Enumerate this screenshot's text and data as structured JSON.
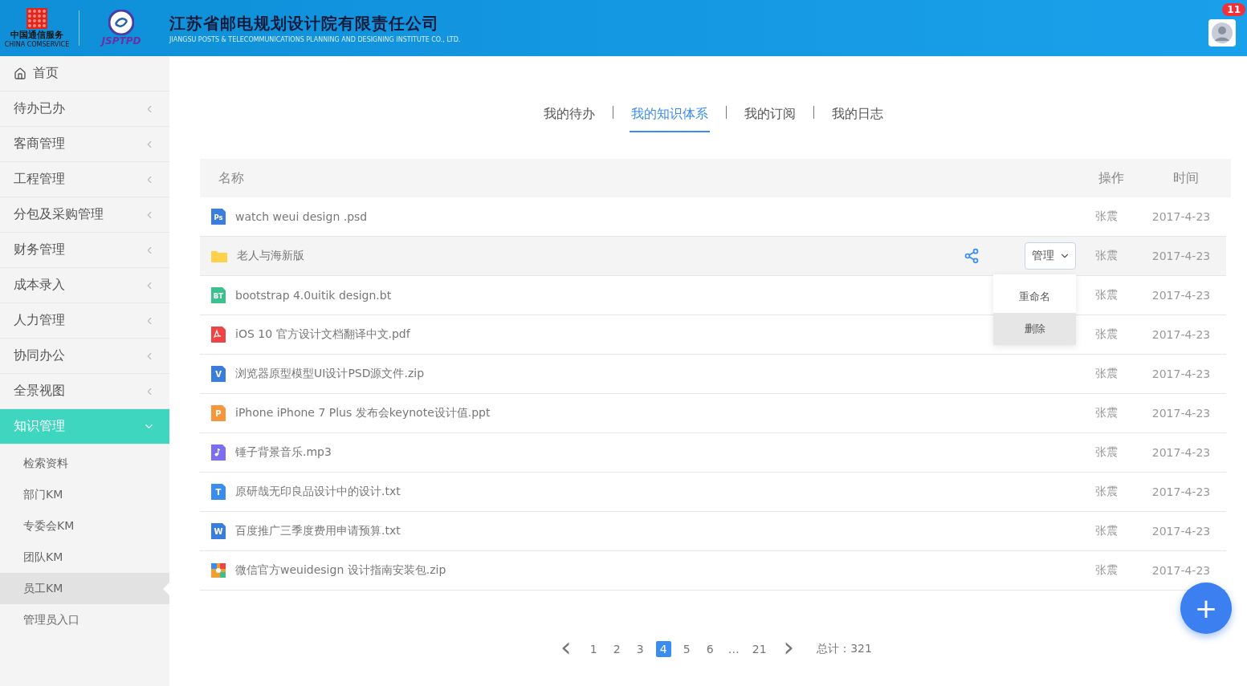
{
  "header": {
    "company": "江苏省邮电规划设计院有限责任公司",
    "company_en": "JIANGSU POSTS & TELECOMMUNICATIONS PLANNING AND DESIGNING INSTITUTE CO., LTD.",
    "logo_cn": "中国通信服务",
    "logo_en": "CHINA COMSERVICE",
    "logo2": "JSPTPD",
    "notifications": "11"
  },
  "sidebar": {
    "items": [
      {
        "label": "首页",
        "kind": "home",
        "selected": false
      },
      {
        "label": "待办已办",
        "kind": "group",
        "expanded": false,
        "selected": false
      },
      {
        "label": "客商管理",
        "kind": "group",
        "expanded": false,
        "selected": false
      },
      {
        "label": "工程管理",
        "kind": "group",
        "expanded": false,
        "selected": false
      },
      {
        "label": "分包及采购管理",
        "kind": "group",
        "expanded": false,
        "selected": false
      },
      {
        "label": "财务管理",
        "kind": "group",
        "expanded": false,
        "selected": false
      },
      {
        "label": "成本录入",
        "kind": "group",
        "expanded": false,
        "selected": false
      },
      {
        "label": "人力管理",
        "kind": "group",
        "expanded": false,
        "selected": false
      },
      {
        "label": "协同办公",
        "kind": "group",
        "expanded": false,
        "selected": false
      },
      {
        "label": "全景视图",
        "kind": "group",
        "expanded": false,
        "selected": false
      },
      {
        "label": "知识管理",
        "kind": "group",
        "expanded": true,
        "selected": true,
        "children": [
          {
            "label": "检索资料",
            "selected": false
          },
          {
            "label": "部门KM",
            "selected": false
          },
          {
            "label": "专委会KM",
            "selected": false
          },
          {
            "label": "团队KM",
            "selected": false
          },
          {
            "label": "员工KM",
            "selected": true
          },
          {
            "label": "管理员入口",
            "selected": false
          }
        ]
      }
    ]
  },
  "tabs": [
    {
      "label": "我的待办",
      "selected": false
    },
    {
      "label": "我的知识体系",
      "selected": true
    },
    {
      "label": "我的订阅",
      "selected": false
    },
    {
      "label": "我的日志",
      "selected": false
    }
  ],
  "table": {
    "columns": [
      "名称",
      "操作",
      "时间"
    ],
    "rows": [
      {
        "icon": {
          "kind": "doc",
          "badge": "Ps",
          "color": "#3b7ddd"
        },
        "name": "watch weui design .psd",
        "author": "张震",
        "date": "2017-4-23",
        "selected": false
      },
      {
        "icon": {
          "kind": "folder",
          "color": "#ffd04a"
        },
        "name": "老人与海新版",
        "author": "张震",
        "date": "2017-4-23",
        "selected": true,
        "manage": "管理",
        "menu": [
          {
            "label": "重命名",
            "selected": false
          },
          {
            "label": "删除",
            "selected": true
          }
        ]
      },
      {
        "icon": {
          "kind": "doc",
          "badge": "BT",
          "color": "#3cc08f"
        },
        "name": "bootstrap 4.0uitik design.bt",
        "author": "张震",
        "date": "2017-4-23",
        "selected": false
      },
      {
        "icon": {
          "kind": "pdf",
          "color": "#ef4444"
        },
        "name": "iOS 10 官方设计文档翻译中文.pdf",
        "author": "张震",
        "date": "2017-4-23",
        "selected": false
      },
      {
        "icon": {
          "kind": "doc",
          "badge": "V",
          "color": "#3b7ddd"
        },
        "name": "浏览器原型模型UI设计PSD源文件.zip",
        "author": "张震",
        "date": "2017-4-23",
        "selected": false
      },
      {
        "icon": {
          "kind": "doc",
          "badge": "P",
          "color": "#f7953a"
        },
        "name": "iPhone iPhone 7 Plus 发布会keynote设计值.ppt",
        "author": "张震",
        "date": "2017-4-23",
        "selected": false
      },
      {
        "icon": {
          "kind": "music",
          "color": "#7c6ef0"
        },
        "name": "锤子背景音乐.mp3",
        "author": "张震",
        "date": "2017-4-23",
        "selected": false
      },
      {
        "icon": {
          "kind": "doc",
          "badge": "T",
          "color": "#3b8cf0"
        },
        "name": "原研哉无印良品设计中的设计.txt",
        "author": "张震",
        "date": "2017-4-23",
        "selected": false
      },
      {
        "icon": {
          "kind": "doc",
          "badge": "W",
          "color": "#3b7ddd"
        },
        "name": "百度推广三季度费用申请预算.txt",
        "author": "张震",
        "date": "2017-4-23",
        "selected": false
      },
      {
        "icon": {
          "kind": "archive",
          "color": "#f0a030"
        },
        "name": "微信官方weuidesign 设计指南安装包.zip",
        "author": "张震",
        "date": "2017-4-23",
        "selected": false
      }
    ]
  },
  "pagination": {
    "prev": "‹",
    "next": "›",
    "pages": [
      {
        "label": "1",
        "selected": false
      },
      {
        "label": "2",
        "selected": false
      },
      {
        "label": "3",
        "selected": false
      },
      {
        "label": "4",
        "selected": true
      },
      {
        "label": "5",
        "selected": false
      },
      {
        "label": "6",
        "selected": false
      },
      {
        "label": "…",
        "selected": false
      },
      {
        "label": "21",
        "selected": false
      }
    ],
    "total": "总计：321"
  },
  "fab": "+"
}
